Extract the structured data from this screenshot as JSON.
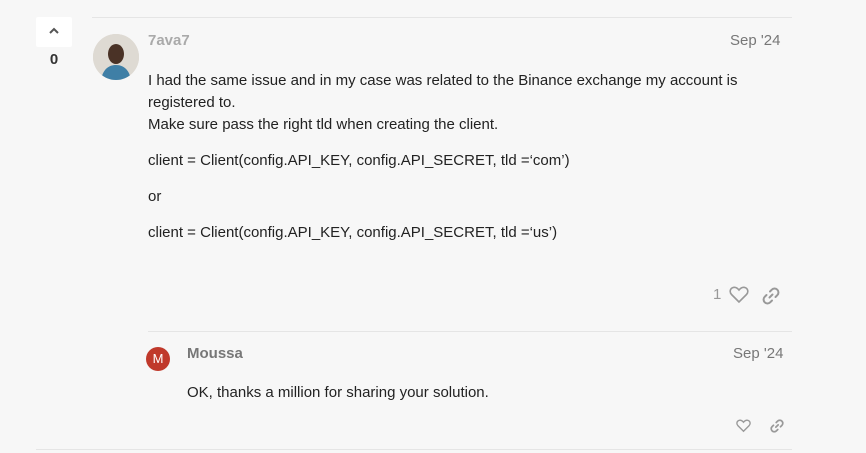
{
  "vote": {
    "count": "0"
  },
  "post": {
    "username": "7ava7",
    "date": "Sep '24",
    "paragraphs": [
      "I had the same issue and in my case was related to the Binance exchange my account is registered to.\nMake sure pass the right tld when creating the client.",
      "client = Client(config.API_KEY, config.API_SECRET, tld =‘com’)",
      "or",
      "client = Client(config.API_KEY, config.API_SECRET, tld =‘us’)"
    ],
    "like_count": "1"
  },
  "reply": {
    "avatar_letter": "M",
    "username": "Moussa",
    "date": "Sep '24",
    "text": "OK, thanks a million for sharing your solution."
  },
  "colors": {
    "accent": "#c0392b",
    "muted": "#999999"
  },
  "icons": {
    "vote": "chevron-up-icon",
    "like": "heart-icon",
    "share": "link-icon"
  }
}
